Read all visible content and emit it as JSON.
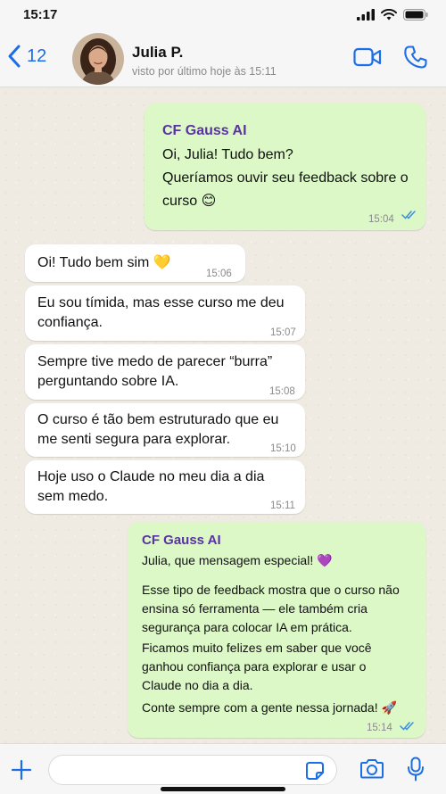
{
  "status_bar": {
    "time": "15:17"
  },
  "header": {
    "back_count": "12",
    "contact_name": "Julia P.",
    "contact_status": "visto por último hoje às 15:11"
  },
  "messages": [
    {
      "direction": "out",
      "sender": "CF Gauss AI",
      "lines": [
        "Oi, Julia! Tudo bem?",
        "Queríamos ouvir seu feedback sobre o",
        "curso 😊"
      ],
      "time": "15:04",
      "read": true
    },
    {
      "direction": "in",
      "lines": [
        "Oi! Tudo bem sim 💛"
      ],
      "time": "15:06"
    },
    {
      "direction": "in",
      "lines": [
        "Eu sou tímida, mas esse curso me deu",
        "confiança."
      ],
      "time": "15:07"
    },
    {
      "direction": "in",
      "lines": [
        "Sempre tive medo de parecer “burra”",
        "perguntando sobre IA."
      ],
      "time": "15:08"
    },
    {
      "direction": "in",
      "lines": [
        "O curso é tão bem estruturado que eu",
        "me senti segura para explorar."
      ],
      "time": "15:10"
    },
    {
      "direction": "in",
      "lines": [
        "Hoje uso o Claude no meu dia a dia",
        "sem medo."
      ],
      "time": "15:11"
    },
    {
      "direction": "out",
      "sender": "CF Gauss AI",
      "paragraphs": [
        [
          "Julia, que mensagem especial! 💜"
        ],
        [
          "Esse tipo de feedback mostra que o curso não",
          "ensina só ferramenta — ele também cria",
          "segurança para colocar IA em prática."
        ],
        [
          "Ficamos muito felizes em saber que você",
          "ganhou confiança para explorar e usar o",
          "Claude no dia a dia."
        ],
        [
          "Conte sempre com a gente nessa jornada! 🚀"
        ]
      ],
      "time": "15:14",
      "read": true
    }
  ],
  "composer": {
    "value": "",
    "placeholder": ""
  },
  "colors": {
    "accent": "#1c6ee8",
    "outgoing_bubble": "#dbf8c6",
    "incoming_bubble": "#ffffff",
    "sender_name": "#5a32a6",
    "read_ticks": "#3b8ee0"
  },
  "icons": [
    "back-chevron-icon",
    "video-call-icon",
    "phone-icon",
    "plus-icon",
    "sticker-icon",
    "camera-icon",
    "microphone-icon",
    "signal-icon",
    "wifi-icon",
    "battery-icon"
  ]
}
